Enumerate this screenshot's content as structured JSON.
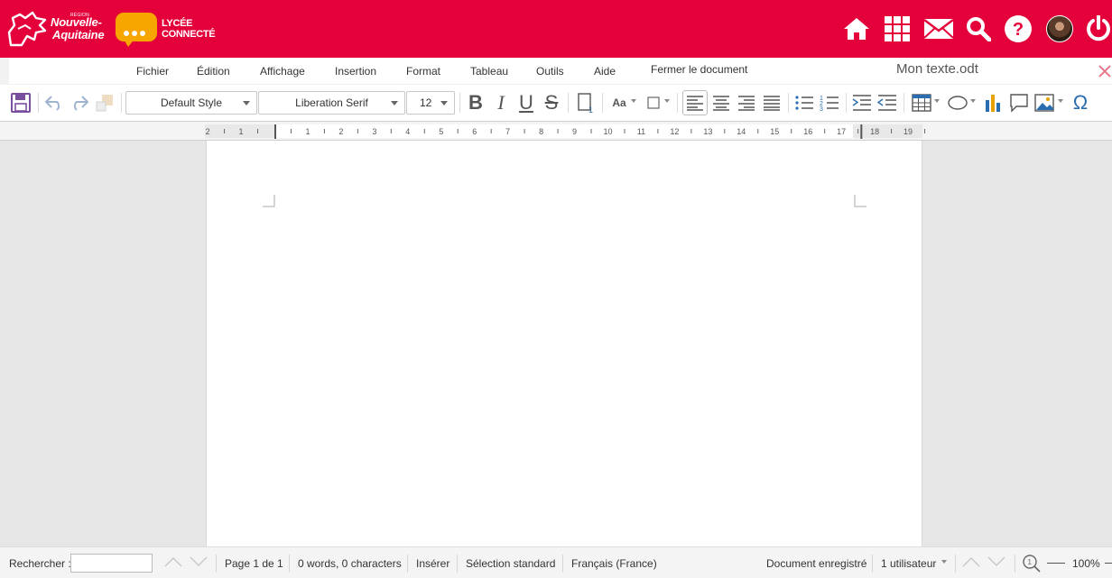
{
  "header": {
    "region_logo": {
      "small": "RÉGION",
      "line1": "Nouvelle-",
      "line2": "Aquitaine"
    },
    "lycee_logo": {
      "line1": "LYCÉE",
      "line2": "CONNECTÉ"
    },
    "icons": [
      "home-icon",
      "apps-grid-icon",
      "mail-icon",
      "search-icon",
      "help-icon",
      "avatar",
      "power-icon"
    ]
  },
  "menu": {
    "items": [
      "Fichier",
      "Édition",
      "Affichage",
      "Insertion",
      "Format",
      "Tableau",
      "Outils",
      "Aide"
    ],
    "close_document": "Fermer le document",
    "doc_title": "Mon texte.odt"
  },
  "toolbar": {
    "paragraph_style": "Default Style",
    "font_name": "Liberation Serif",
    "font_size": "12",
    "case_label": "Aa",
    "bold": "B",
    "italic": "I",
    "underline": "U",
    "strike": "S",
    "special_char": "Ω"
  },
  "ruler": {
    "left_labels": [
      "2",
      "1"
    ],
    "labels": [
      "1",
      "2",
      "3",
      "4",
      "5",
      "6",
      "7",
      "8",
      "9",
      "10",
      "11",
      "12",
      "13",
      "14",
      "15",
      "16",
      "17",
      "18",
      "19"
    ]
  },
  "statusbar": {
    "search_label": "Rechercher :",
    "search_value": "",
    "page_info": "Page 1 de 1",
    "word_count": "0 words, 0 characters",
    "insert_mode": "Insérer",
    "selection_mode": "Sélection standard",
    "language": "Français (France)",
    "save_status": "Document enregistré",
    "users": "1 utilisateur",
    "zoom": "100%"
  },
  "colors": {
    "brand_red": "#e4003a",
    "lycee_orange": "#f7a600",
    "save_purple": "#7b4fa0",
    "toolbar_blue": "#2a6db0"
  }
}
